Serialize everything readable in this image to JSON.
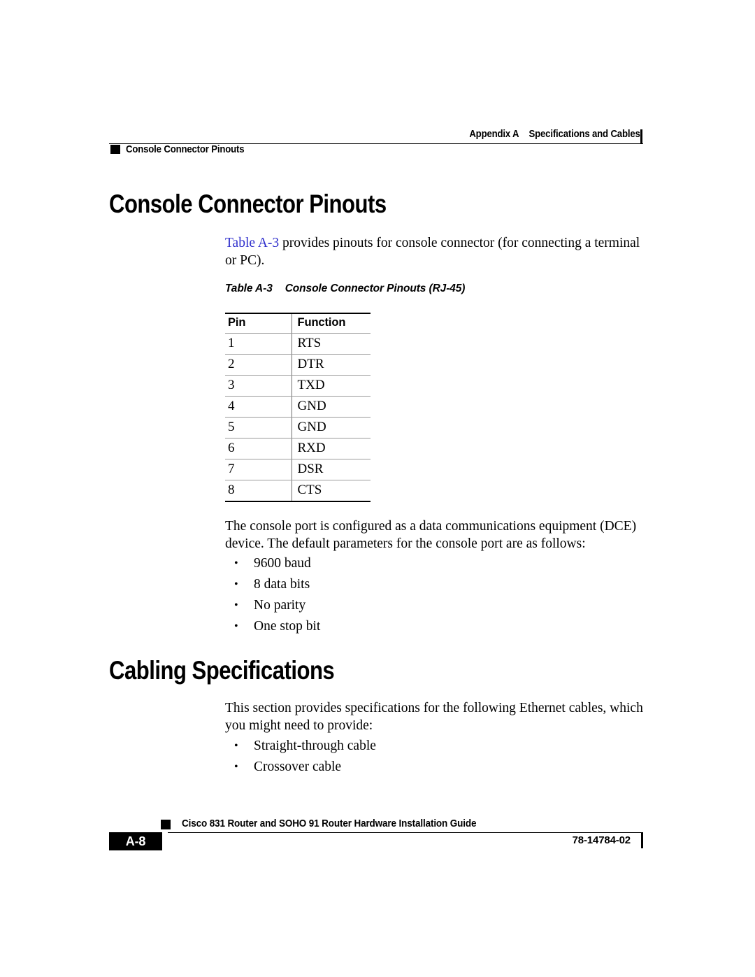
{
  "header": {
    "appendix_label": "Appendix A",
    "appendix_title": "Specifications and Cables",
    "running_head": "Console Connector Pinouts"
  },
  "sections": [
    {
      "heading": "Console Connector Pinouts",
      "intro_link": "Table A-3",
      "intro_rest": " provides pinouts for console connector (for connecting a terminal or PC).",
      "table": {
        "caption_number": "Table A-3",
        "caption_title": "Console Connector Pinouts (RJ-45)",
        "columns": [
          "Pin",
          "Function"
        ],
        "rows": [
          [
            "1",
            "RTS"
          ],
          [
            "2",
            "DTR"
          ],
          [
            "3",
            "TXD"
          ],
          [
            "4",
            "GND"
          ],
          [
            "5",
            "GND"
          ],
          [
            "6",
            "RXD"
          ],
          [
            "7",
            "DSR"
          ],
          [
            "8",
            "CTS"
          ]
        ]
      },
      "paragraph": "The console port is configured as a data communications equipment (DCE) device. The default parameters for the console port are as follows:",
      "bullets": [
        "9600 baud",
        "8 data bits",
        "No parity",
        "One stop bit"
      ]
    },
    {
      "heading": "Cabling Specifications",
      "paragraph": "This section provides specifications for the following Ethernet cables, which you might need to provide:",
      "bullets": [
        "Straight-through cable",
        "Crossover cable"
      ]
    }
  ],
  "footer": {
    "page_number": "A-8",
    "document_title": "Cisco 831 Router and SOHO 91 Router Hardware Installation Guide",
    "document_number": "78-14784-02"
  },
  "colors": {
    "link": "#2f2fcc",
    "rule": "#000000",
    "text": "#000000"
  }
}
